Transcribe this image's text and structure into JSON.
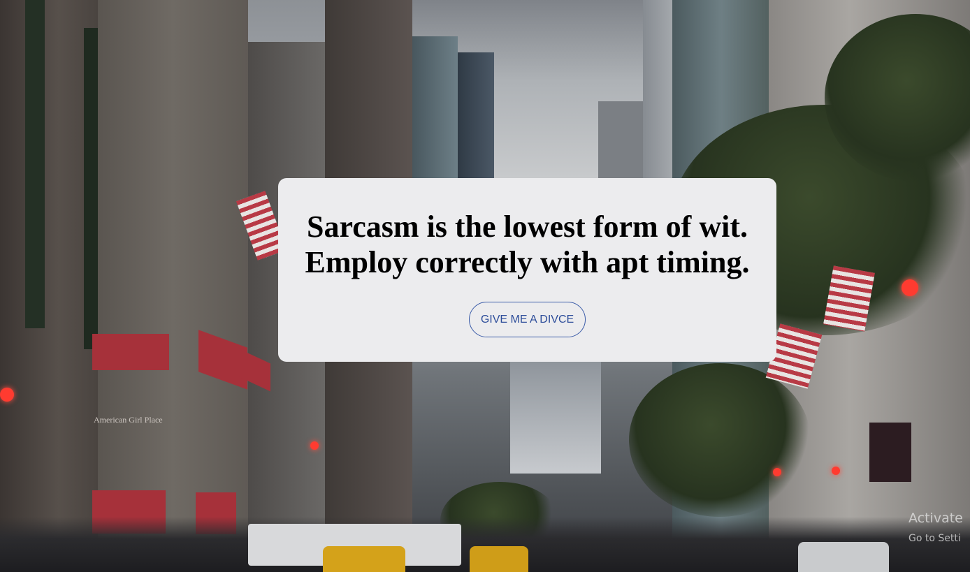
{
  "quote": {
    "line1": "Sarcasm is the lowest form of wit.",
    "line2": "Employ correctly with apt timing."
  },
  "button": {
    "label": "GIVE ME A DIVCE"
  },
  "background": {
    "store_sign": "American Girl Place"
  },
  "os_watermark": {
    "title": "Activate",
    "subtitle": "Go to Setti"
  },
  "colors": {
    "card_bg": "#ececee",
    "button_border": "#3a5ba8",
    "button_text": "#2d4d9a",
    "quote_text": "#000000"
  }
}
